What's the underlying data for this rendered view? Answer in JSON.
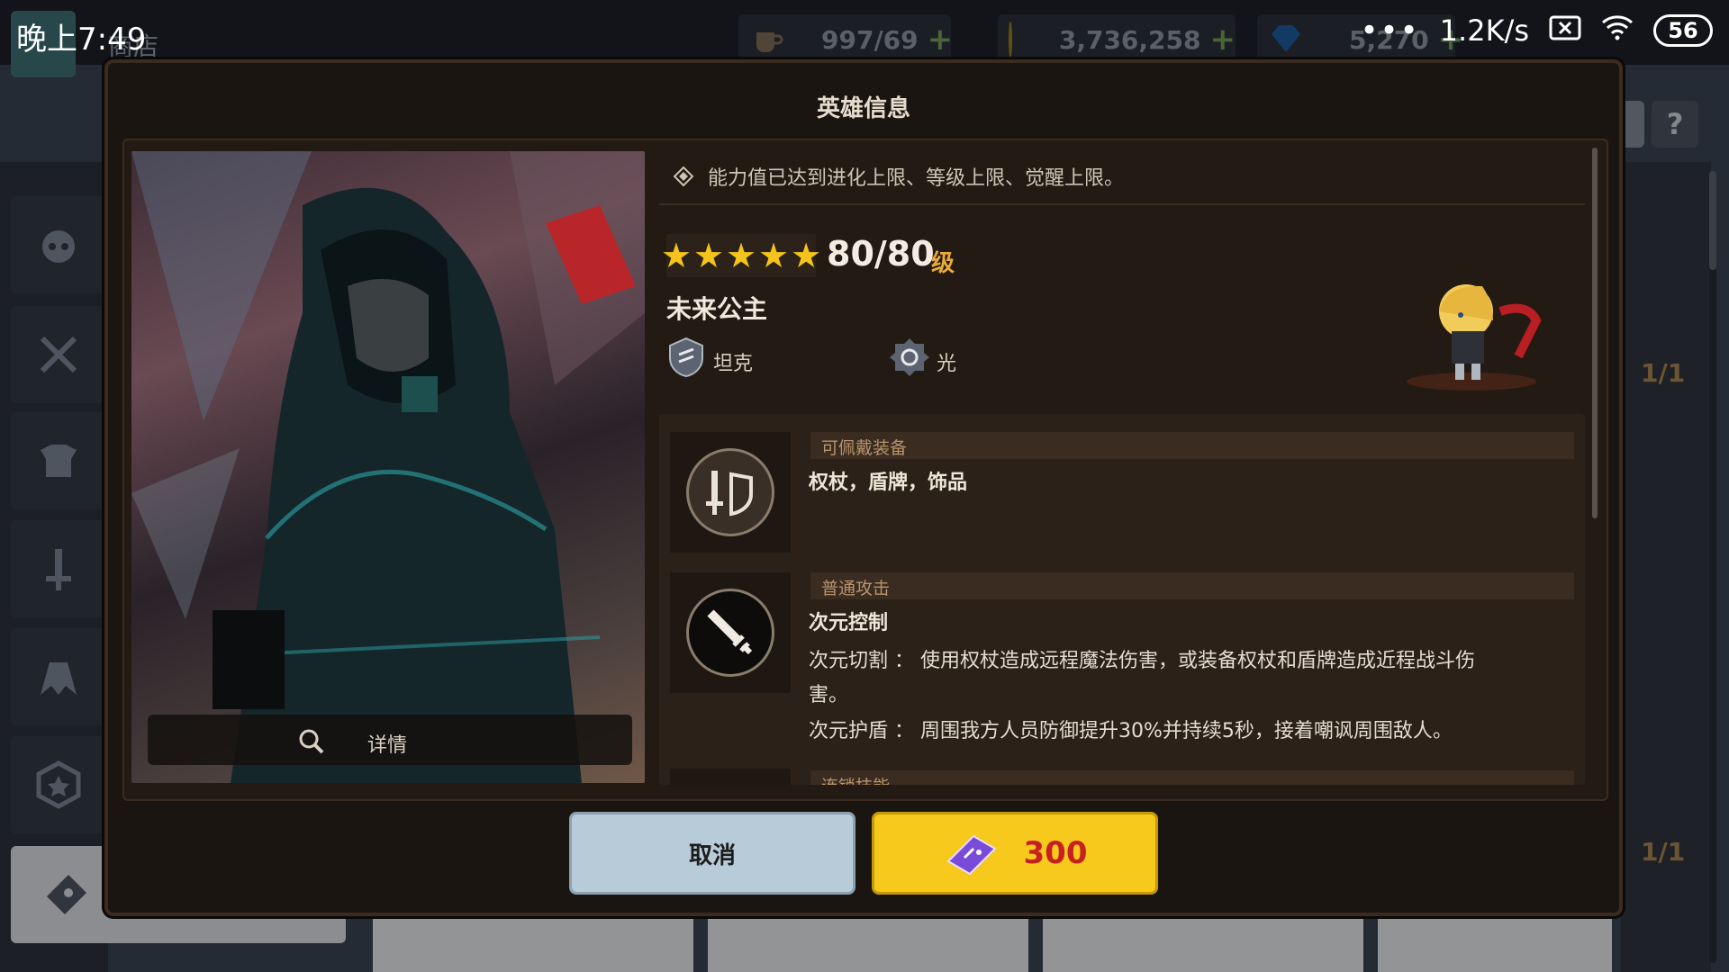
{
  "status_bar": {
    "time": "晚上7:49",
    "net_speed": "1.2K/s",
    "battery": "56"
  },
  "header": {
    "title": "商店",
    "resources": [
      {
        "name": "stamina",
        "icon": "coffee-cup-icon",
        "value": "997/69"
      },
      {
        "name": "gold",
        "icon": "gold-coin-icon",
        "value": "3,736,258"
      },
      {
        "name": "gem",
        "icon": "blue-gem-icon",
        "value": "5,270"
      }
    ],
    "help_label": "?"
  },
  "background": {
    "fraction_1": "1/1",
    "fraction_2": "1/1"
  },
  "modal": {
    "title": "英雄信息",
    "notice": "能力值已达到进化上限、等级上限、觉醒上限。",
    "stars": 5,
    "level": "80/80",
    "level_unit": "级",
    "hero_name": "未来公主",
    "role": "坦克",
    "element": "光",
    "detail_label": "详情",
    "sections": [
      {
        "header": "可佩戴装备",
        "title": "权杖，盾牌，饰品"
      },
      {
        "header": "普通攻击",
        "title": "次元控制",
        "line1": "次元切割 ： 使用权杖造成远程魔法伤害，或装备权杖和盾牌造成近程战斗伤",
        "line2": "害。",
        "line3": "次元护盾 ： 周围我方人员防御提升30%并持续5秒，接着嘲讽周围敌人。"
      },
      {
        "header": "连锁技能"
      }
    ],
    "cancel_label": "取消",
    "price": "300"
  },
  "colors": {
    "accent_gold": "#f6c91c",
    "price_red": "#c62020",
    "level_unit": "#e9a93a"
  }
}
